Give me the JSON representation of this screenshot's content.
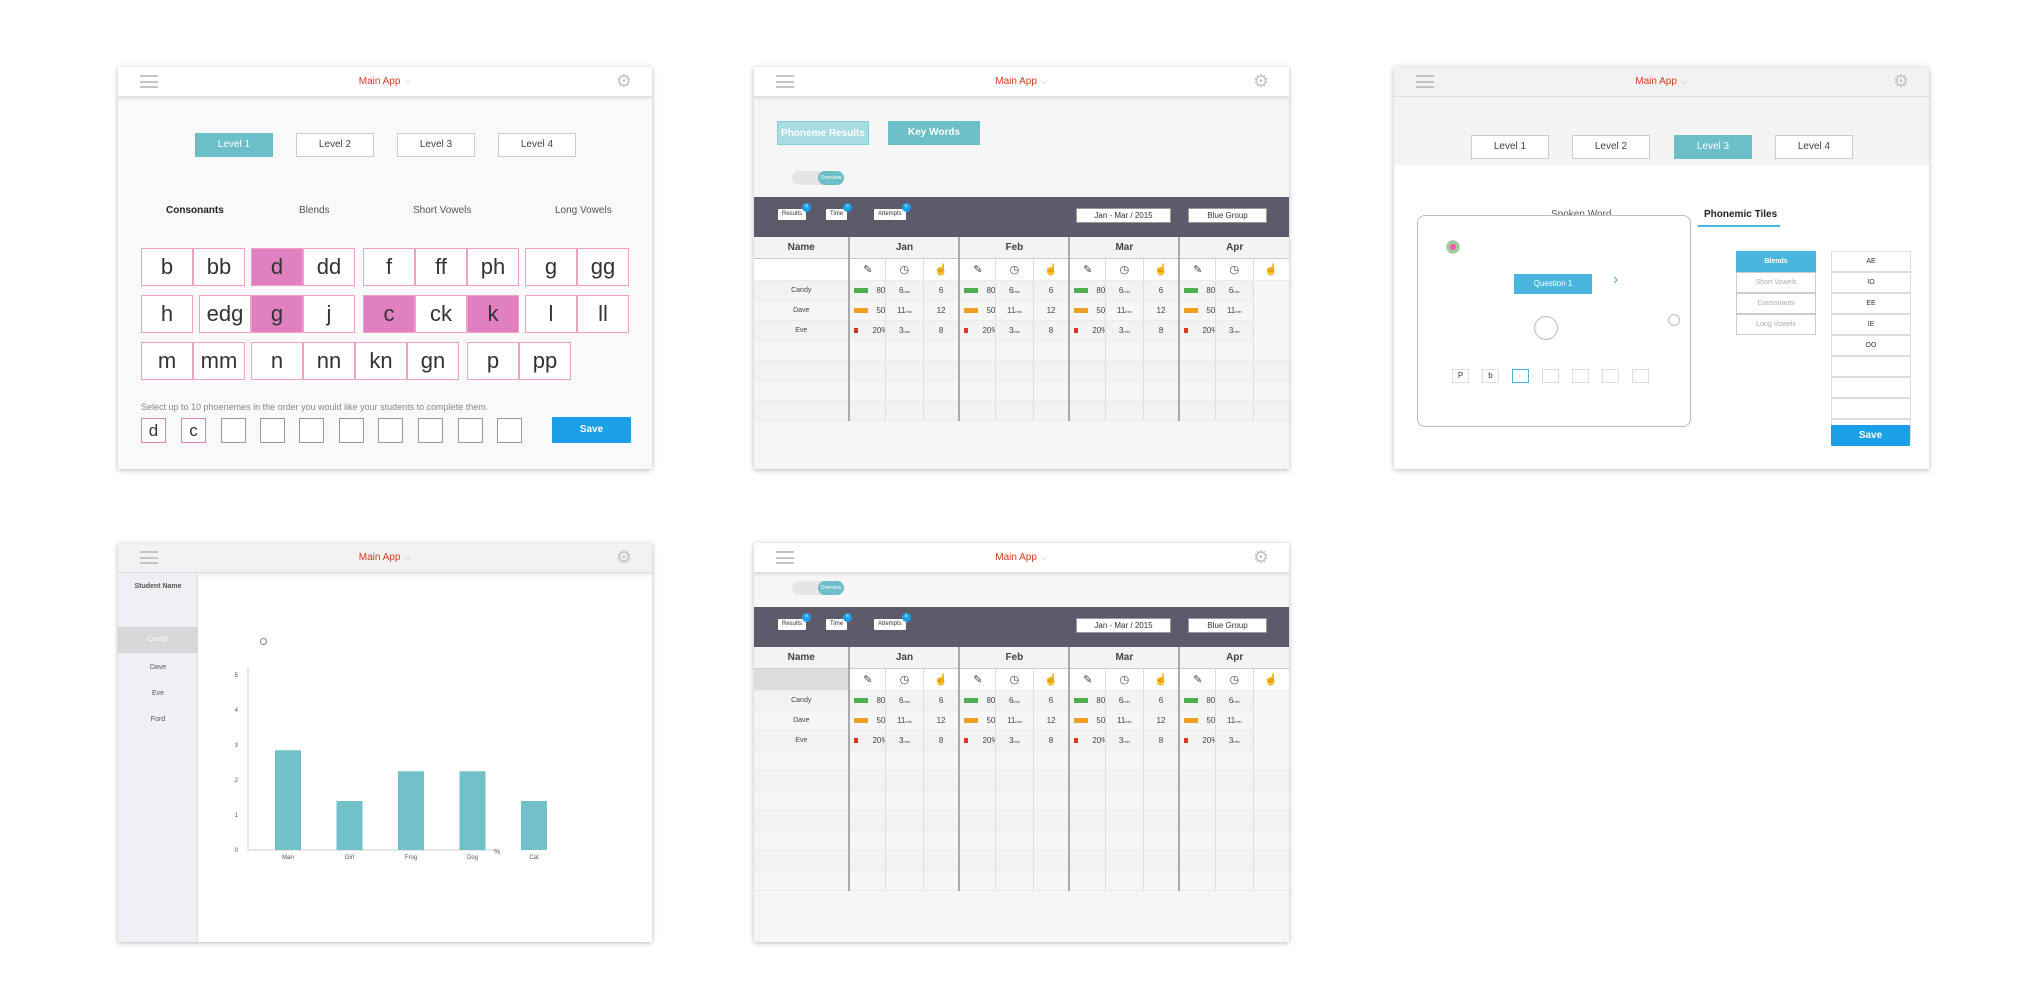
{
  "common": {
    "app_title": "Main App",
    "chevron": "⌵",
    "gear": "⚙"
  },
  "p1": {
    "levels": [
      "Level 1",
      "Level 2",
      "Level 3",
      "Level 4"
    ],
    "categories": [
      "Consonants",
      "Blends",
      "Short Vowels",
      "Long Vowels"
    ],
    "tiles": [
      "b",
      "bb",
      "d",
      "dd",
      "f",
      "ff",
      "ph",
      "g",
      "gg",
      "h",
      "edg",
      "g",
      "j",
      "c",
      "ck",
      "k",
      "l",
      "ll",
      "m",
      "mm",
      "n",
      "nn",
      "kn",
      "gn",
      "p",
      "pp"
    ],
    "instruction": "Select up to 10 phoenemes in the order you would like your students to complete them.",
    "slots": [
      "d",
      "c",
      "",
      "",
      "",
      "",
      "",
      "",
      "",
      ""
    ],
    "save": "Save"
  },
  "results": {
    "tabs": [
      "Phoneme Results",
      "Key Words"
    ],
    "toggle_label": "Overview",
    "chips": [
      "Results",
      "Time",
      "Attempts"
    ],
    "chip_x": "×",
    "date_range": "Jan - Mar / 2015",
    "group": "Blue Group",
    "name_header": "Name",
    "months": [
      "Jan",
      "Feb",
      "Mar",
      "Apr"
    ],
    "icons": [
      "✎",
      "◷",
      "☝"
    ],
    "students": [
      {
        "name": "Candy",
        "score": "80%",
        "time": "6",
        "time_unit": "min",
        "attempts": "6",
        "color": "#4cae4c"
      },
      {
        "name": "Dave",
        "score": "50%",
        "time": "11",
        "time_unit": "min",
        "attempts": "12",
        "color": "#f0a020"
      },
      {
        "name": "Eve",
        "score": "20%",
        "time": "3",
        "time_unit": "min",
        "attempts": "8",
        "color": "#d9381e"
      }
    ]
  },
  "p3": {
    "levels": [
      "Level 1",
      "Level 2",
      "Level 3",
      "Level 4"
    ],
    "subtabs": [
      "Spoken Word",
      "Phonemic Tiles"
    ],
    "question": "Question 1",
    "next_arrow": "›",
    "tablet_tiles": [
      "P",
      "b",
      "",
      "",
      "",
      "",
      ""
    ],
    "categories": [
      "Blends",
      "Short Vowels",
      "Consonants",
      "Long Vowels"
    ],
    "vowels": [
      "AE",
      "IO",
      "EE",
      "IE",
      "OO",
      "",
      "",
      "",
      ""
    ],
    "save": "Save"
  },
  "p4": {
    "sidebar_title": "Student Name",
    "students": [
      "Candy",
      "Dave",
      "Eve",
      "Ford"
    ]
  },
  "chart_data": {
    "type": "bar",
    "categories": [
      "Man",
      "Girl",
      "Frog",
      "Dog",
      "Cat"
    ],
    "values": [
      2.85,
      1.4,
      2.25,
      2.25,
      1.4
    ],
    "yticks": [
      "0",
      "1",
      "2",
      "3",
      "4",
      "5"
    ],
    "ylim": [
      0,
      5
    ],
    "xlabel": "%",
    "color": "#72c1c9"
  }
}
